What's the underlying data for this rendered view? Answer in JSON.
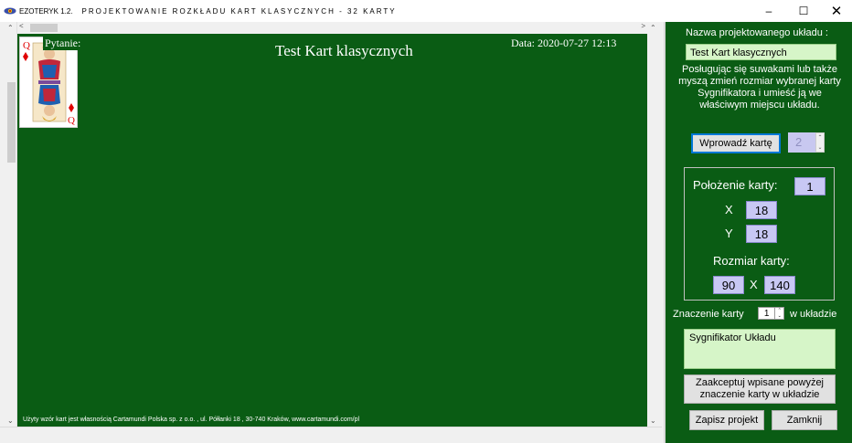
{
  "window": {
    "app_name": "EZOTERYK 1.2.",
    "title": "PROJEKTOWANIE ROZKŁADU KART KLASYCZNYCH - 32 KARTY",
    "minimize": "–",
    "maximize": "☐",
    "close": "✕"
  },
  "scrollbars": {
    "up": "⌃",
    "down": "⌄",
    "left": "<",
    "right": ">"
  },
  "canvas": {
    "card_label": "Pytanie:",
    "title": "Test Kart klasycznych",
    "date": "Data: 2020-07-27 12:13",
    "footer": "Użyty wzór kart jest własnością Cartamundi Polska sp. z o.o. , ul. Półłanki 18 , 30-740 Kraków, www.cartamundi.com/pl",
    "card": {
      "rank": "Q",
      "suit_icon": "diamond-icon",
      "suit_color": "#e00000"
    }
  },
  "panel": {
    "name_label": "Nazwa projektowanego układu :",
    "name_value": "Test Kart klasycznych",
    "instructions": "Posługując się suwakami lub także myszą zmień rozmiar wybranej karty Sygnifikatora i umieść ją we właściwym miejscu układu.",
    "insert_button": "Wprowadź kartę",
    "card_number": "2",
    "position_label": "Położenie karty:",
    "position_value": "1",
    "x_label": "X",
    "x_value": "18",
    "y_label": "Y",
    "y_value": "18",
    "size_label": "Rozmiar karty:",
    "width_value": "90",
    "times": "X",
    "height_value": "140",
    "meaning_prefix": "Znaczenie karty",
    "meaning_index": "1",
    "meaning_suffix": "w układzie",
    "meaning_text": "Sygnifikator Układu",
    "accept_button": "Zaakceptuj wpisane powyżej znaczenie karty w układzie",
    "save_button": "Zapisz projekt",
    "close_button": "Zamknij"
  },
  "colors": {
    "felt": "#0a5c14",
    "field": "#d6f5c8",
    "value_box": "#c8c8f4"
  }
}
